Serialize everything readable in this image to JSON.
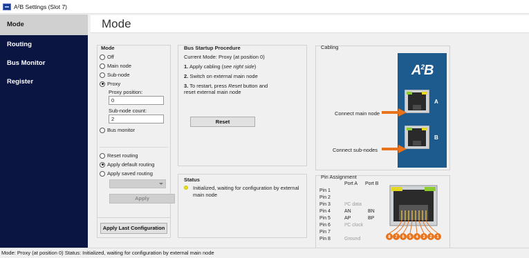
{
  "window": {
    "title": "A²B Settings (Slot 7)"
  },
  "sidebar": {
    "items": [
      {
        "label": "Mode"
      },
      {
        "label": "Routing"
      },
      {
        "label": "Bus Monitor"
      },
      {
        "label": "Register"
      }
    ]
  },
  "page": {
    "title": "Mode"
  },
  "mode": {
    "title": "Mode",
    "options": [
      "Off",
      "Main node",
      "Sub-node",
      "Proxy"
    ],
    "selected": "Proxy",
    "proxy_position_label": "Proxy position:",
    "proxy_position_value": "0",
    "subnode_count_label": "Sub-node count:",
    "subnode_count_value": "2",
    "bus_monitor_label": "Bus monitor",
    "routing": {
      "options": [
        "Reset routing",
        "Apply default routing",
        "Apply saved routing"
      ],
      "selected": "Apply default routing",
      "apply_label": "Apply"
    },
    "apply_last_label": "Apply Last Configuration"
  },
  "startup": {
    "title": "Bus Startup Procedure",
    "current_mode": "Current Mode: Proxy (at position 0)",
    "step1_num": "1.",
    "step1_text": "Apply cabling (",
    "step1_em": "see right side",
    "step1_end": ")",
    "step2_num": "2.",
    "step2_text": "Switch on external main node",
    "step3_num": "3.",
    "step3_text_a": "To restart, press ",
    "step3_em": "Reset",
    "step3_text_b": " button and",
    "step3_text_c": "reset external main node",
    "reset_label": "Reset"
  },
  "status": {
    "title": "Status",
    "line1": "Initialized, waiting for configuration by external",
    "line2": "main node",
    "indicator_color": "#e8e020"
  },
  "cabling": {
    "title": "Cabling",
    "logo": "A²B",
    "connect_main": "Connect main node",
    "connect_sub": "Connect sub-nodes",
    "port_a": "A",
    "port_b": "B",
    "arrow_color": "#e8731a",
    "panel_color": "#1d5a8e"
  },
  "pins": {
    "title": "Pin Assignment",
    "col_a": "Port A",
    "col_b": "Port B",
    "rows": [
      {
        "pin": "Pin 1",
        "a": "",
        "b": ""
      },
      {
        "pin": "Pin 2",
        "a": "",
        "b": ""
      },
      {
        "pin": "Pin 3",
        "a": "I²C data",
        "b": ""
      },
      {
        "pin": "Pin 4",
        "a": "AN",
        "b": "BN"
      },
      {
        "pin": "Pin 5",
        "a": "AP",
        "b": "BP"
      },
      {
        "pin": "Pin 6",
        "a": "I²C clock",
        "b": ""
      },
      {
        "pin": "Pin 7",
        "a": "",
        "b": ""
      },
      {
        "pin": "Pin 8",
        "a": "Ground",
        "b": ""
      }
    ],
    "numbers": [
      "8",
      "7",
      "6",
      "5",
      "4",
      "3",
      "2",
      "1"
    ]
  },
  "statusbar": {
    "text": "Mode: Proxy (at position 0)   Status: Initialized, waiting for configuration by external main node"
  }
}
